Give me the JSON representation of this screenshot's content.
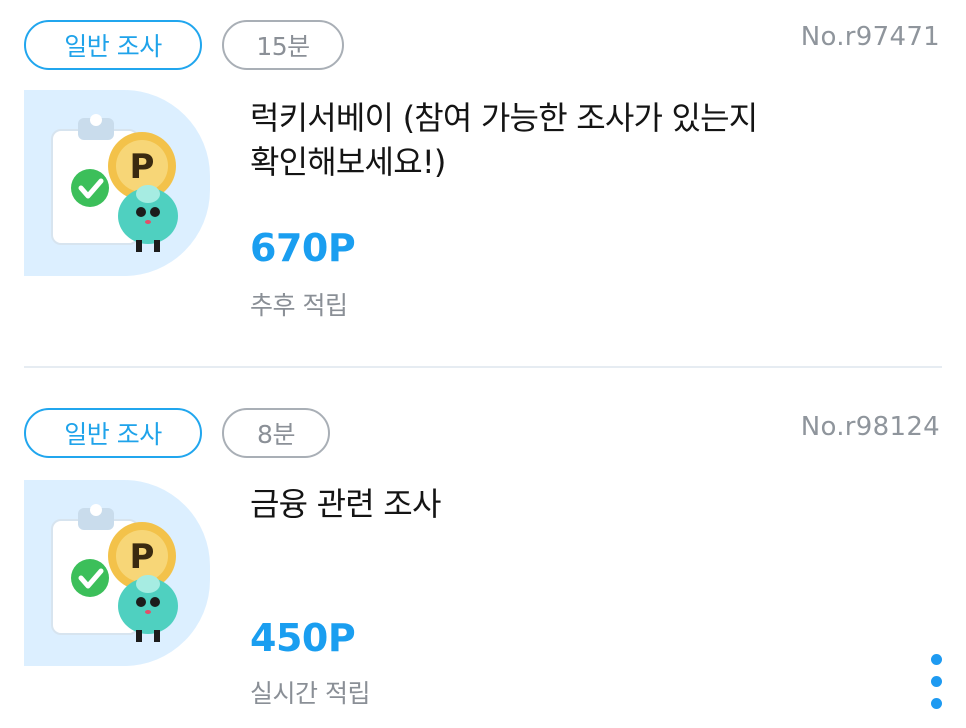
{
  "surveys": [
    {
      "type_label": "일반 조사",
      "duration": "15분",
      "survey_no": "No.r97471",
      "title": "럭키서베이 (참여 가능한 조사가 있는지 확인해보세요!)",
      "points": "670P",
      "reward_timing": "추후 적립",
      "icon": "survey-point-mascot-icon"
    },
    {
      "type_label": "일반 조사",
      "duration": "8분",
      "survey_no": "No.r98124",
      "title": "금융 관련 조사",
      "points": "450P",
      "reward_timing": "실시간 적립",
      "icon": "survey-point-mascot-icon"
    }
  ],
  "more_menu": {
    "icon": "more-vertical-icon"
  },
  "colors": {
    "accent": "#1a9ef0",
    "muted": "#8a8f96",
    "chip_border_gray": "#a9afb6"
  }
}
